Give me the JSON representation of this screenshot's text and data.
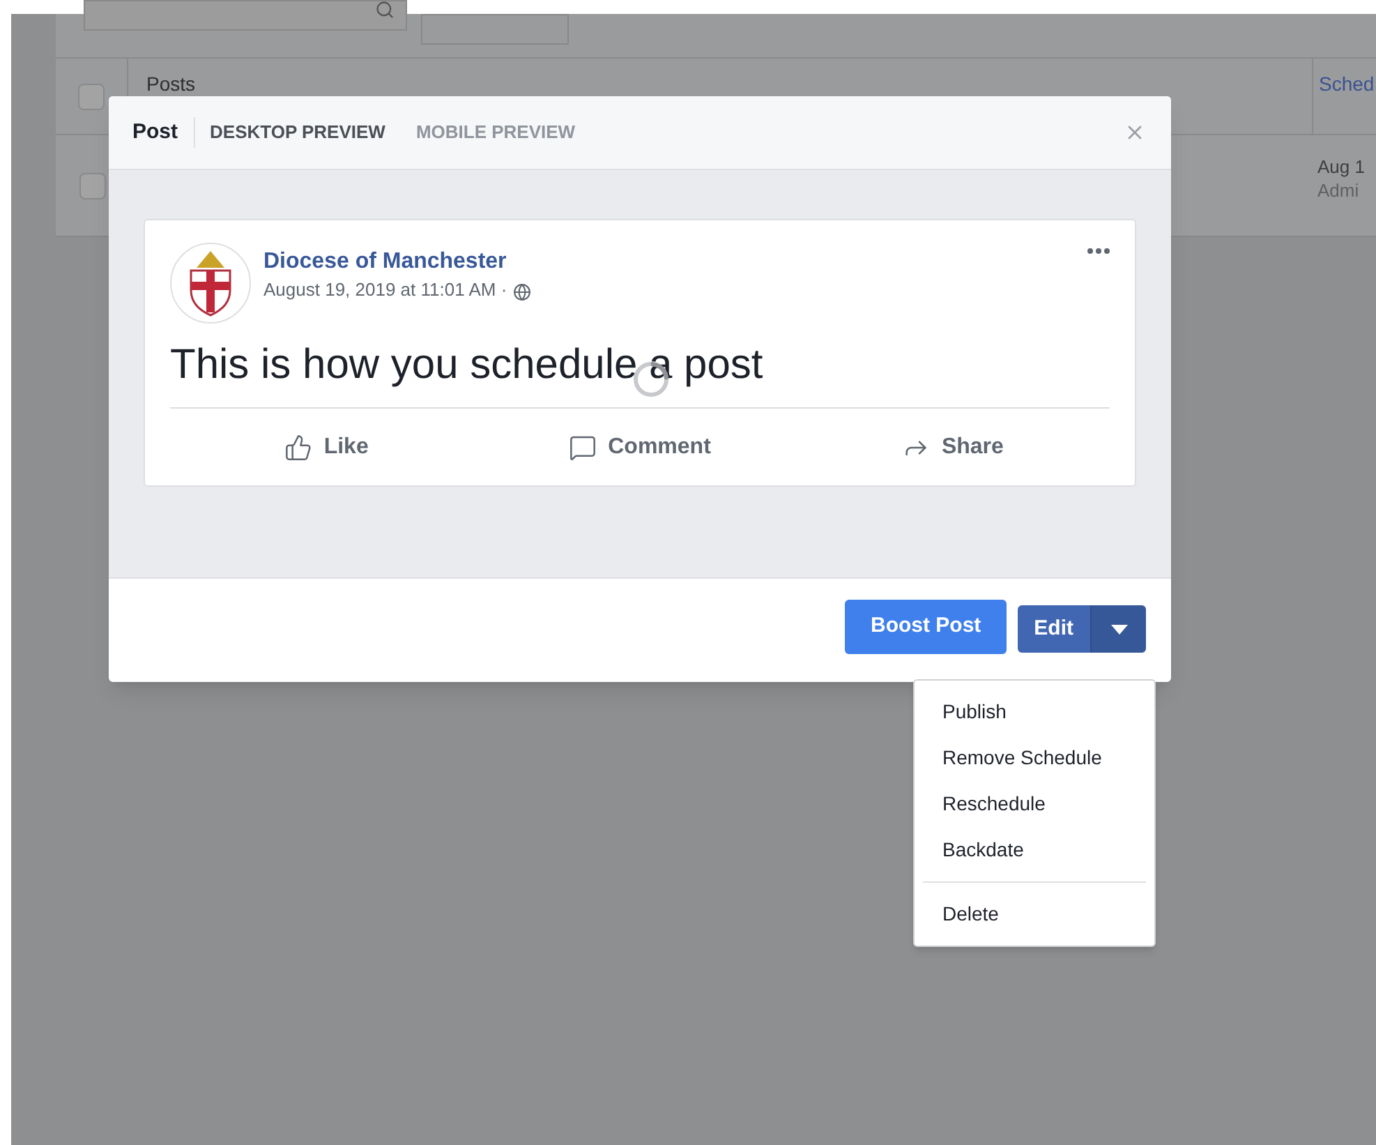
{
  "background": {
    "header": {
      "checked": false,
      "column": "Posts",
      "column_2": "Sched"
    },
    "rows": [
      {
        "checked": false,
        "date": "Aug 1",
        "author": "Admi"
      }
    ]
  },
  "modal": {
    "tabs": [
      {
        "label": "Post",
        "selected": true,
        "hovered": false
      },
      {
        "label": "DESKTOP PREVIEW",
        "selected": false,
        "hovered": true
      },
      {
        "label": "MOBILE PREVIEW",
        "selected": false,
        "hovered": false
      }
    ],
    "post": {
      "page_name": "Diocese of Manchester",
      "timestamp": "August 19, 2019 at 11:01 AM ·",
      "text": "This is how you schedule a post",
      "loading": true,
      "actions": [
        {
          "kind": "like",
          "label": "Like"
        },
        {
          "kind": "comment",
          "label": "Comment"
        },
        {
          "kind": "share",
          "label": "Share"
        }
      ]
    },
    "boost_button": "Boost Post",
    "edit_button": "Edit",
    "menu_open": true
  },
  "menu": {
    "items": [
      {
        "label": "Publish",
        "separated": false
      },
      {
        "label": "Remove Schedule",
        "separated": false
      },
      {
        "label": "Reschedule",
        "separated": false
      },
      {
        "label": "Backdate",
        "separated": false
      },
      {
        "label": "Delete",
        "separated": true
      }
    ]
  }
}
